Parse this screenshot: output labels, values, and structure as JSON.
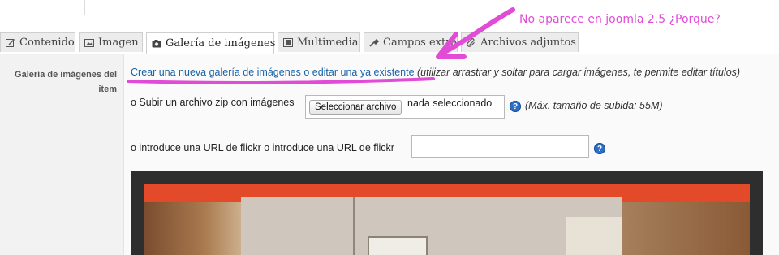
{
  "annotation": {
    "note": "No aparece en joomla 2.5 ¿Porque?",
    "color": "#e24bd6"
  },
  "tabs": [
    {
      "label": "Contenido",
      "icon": "edit-icon",
      "active": false
    },
    {
      "label": "Imagen",
      "icon": "image-icon",
      "active": false
    },
    {
      "label": "Galería de imágenes",
      "icon": "camera-icon",
      "active": true
    },
    {
      "label": "Multimedia",
      "icon": "film-icon",
      "active": false
    },
    {
      "label": "Campos extra",
      "icon": "tools-icon",
      "active": false
    },
    {
      "label": "Archivos adjuntos",
      "icon": "paperclip-icon",
      "active": false
    }
  ],
  "gallery": {
    "field_label": "Galería de imágenes del item",
    "create_link": "Crear una nueva galería de imágenes o editar una ya existente",
    "create_hint": "(utilizar arrastrar y soltar para cargar imágenes, te permite editar títulos)",
    "upload_label": "o Subir un archivo zip con imágenes",
    "upload_button": "Seleccionar archivo",
    "upload_status": "nada seleccionado",
    "upload_help": "?",
    "max_size": "(Máx. tamaño de subida: 55M)",
    "flickr_label": "o introduce una URL de flickr o introduce una URL de flickr",
    "flickr_value": "",
    "flickr_help": "?"
  },
  "colors": {
    "link": "#1a63a6",
    "help_badge": "#2f6fc3",
    "annotation": "#e24bd6"
  }
}
